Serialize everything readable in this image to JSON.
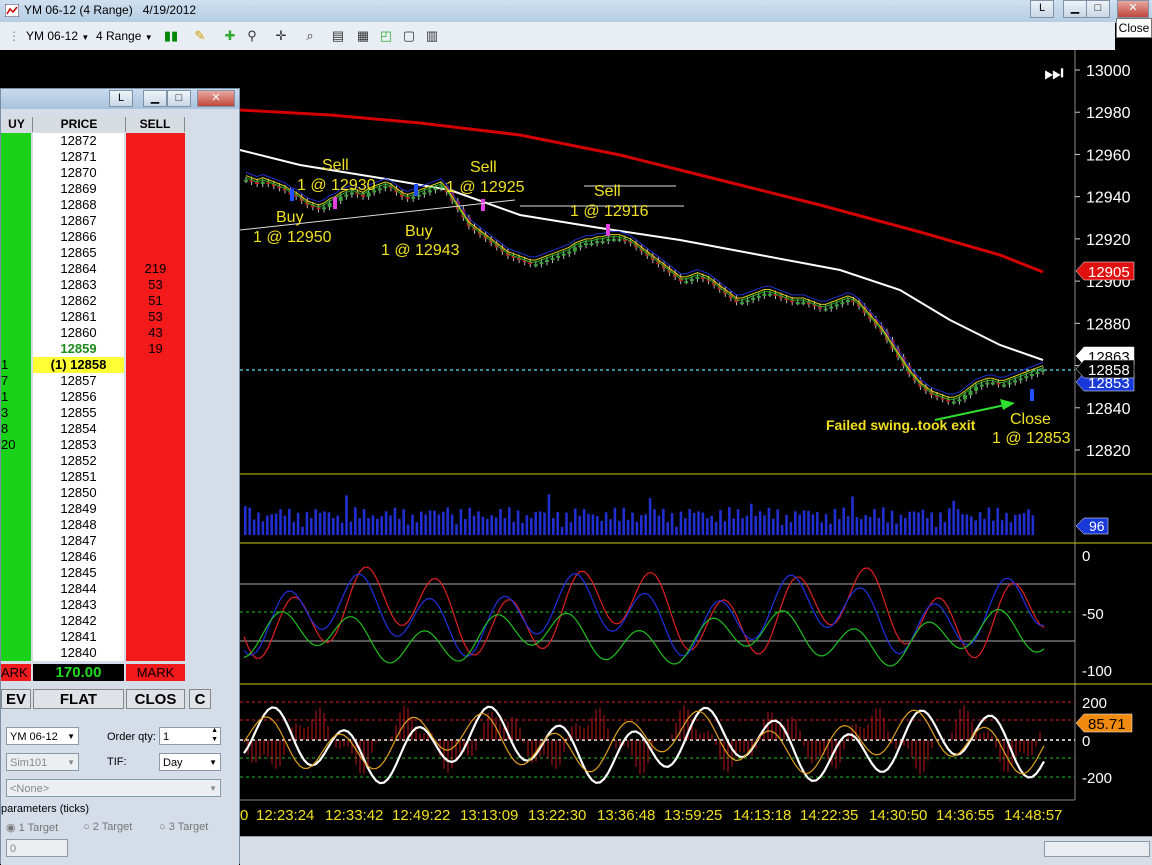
{
  "window": {
    "title": "YM 06-12 (4 Range)   4/19/2012",
    "close_tooltip": "Close",
    "btn_l": "L"
  },
  "toolbar": {
    "instrument": "YM 06-12",
    "interval": "4 Range"
  },
  "chart_data": {
    "type": "candlestick-multi-panel",
    "price_axis": {
      "ticks": [
        "13000",
        "12980",
        "12960",
        "12940",
        "12920",
        "12900",
        "12880",
        "12860",
        "12840",
        "12820"
      ]
    },
    "markers": {
      "current_price": "12858",
      "upper_band_price": "12863",
      "lower_band_price": "12853",
      "red_ma": "12905"
    },
    "volume_label": "96",
    "oscillator1_ticks": [
      "0",
      "-50",
      "-100"
    ],
    "oscillator2_ticks": [
      "200",
      "0",
      "-200"
    ],
    "oscillator2_value": "85.71",
    "time_axis": [
      "0",
      "12:23:24",
      "12:33:42",
      "12:49:22",
      "13:13:09",
      "13:22:30",
      "13:36:48",
      "13:59:25",
      "14:13:18",
      "14:22:35",
      "14:30:50",
      "14:36:55",
      "14:48:57"
    ],
    "annotations": [
      {
        "text": "Sell",
        "text2": "1 @ 12930"
      },
      {
        "text": "Buy",
        "text2": "1 @ 12950"
      },
      {
        "text": "Sell",
        "text2": "1 @ 12925"
      },
      {
        "text": "Buy",
        "text2": "1 @ 12943"
      },
      {
        "text": "Sell",
        "text2": "1 @ 12916"
      },
      {
        "text": "Close",
        "text2": "1 @ 12853"
      },
      {
        "text": "Failed swing..took exit",
        "text2": ""
      }
    ],
    "price_series": [
      12948,
      12947,
      12946,
      12947,
      12946,
      12945,
      12944,
      12943,
      12941,
      12940,
      12938,
      12936,
      12935,
      12934,
      12935,
      12937,
      12938,
      12940,
      12941,
      12942,
      12941,
      12940,
      12942,
      12943,
      12944,
      12945,
      12944,
      12942,
      12940,
      12939,
      12940,
      12941,
      12942,
      12943,
      12944,
      12945,
      12942,
      12938,
      12934,
      12930,
      12926,
      12924,
      12922,
      12920,
      12918,
      12916,
      12914,
      12912,
      12911,
      12910,
      12909,
      12908,
      12908,
      12909,
      12910,
      12911,
      12912,
      12913,
      12914,
      12916,
      12917,
      12918,
      12918,
      12919,
      12919,
      12920,
      12920,
      12920,
      12919,
      12918,
      12916,
      12914,
      12912,
      12910,
      12908,
      12906,
      12904,
      12902,
      12900,
      12900,
      12901,
      12902,
      12901,
      12900,
      12898,
      12896,
      12894,
      12892,
      12890,
      12890,
      12891,
      12892,
      12893,
      12894,
      12894,
      12893,
      12892,
      12891,
      12890,
      12890,
      12890,
      12889,
      12888,
      12887,
      12887,
      12888,
      12889,
      12890,
      12891,
      12890,
      12888,
      12885,
      12882,
      12879,
      12876,
      12872,
      12868,
      12864,
      12860,
      12856,
      12853,
      12850,
      12848,
      12846,
      12845,
      12844,
      12843,
      12843,
      12844,
      12846,
      12848,
      12850,
      12851,
      12852,
      12852,
      12851,
      12851,
      12852,
      12853,
      12854,
      12855,
      12856,
      12857,
      12858
    ]
  },
  "dom": {
    "title_btn": "L",
    "headers": {
      "buy": "UY",
      "price": "PRICE",
      "sell": "SELL"
    },
    "rows": [
      {
        "buy": "",
        "price": "12872",
        "sell": ""
      },
      {
        "buy": "",
        "price": "12871",
        "sell": ""
      },
      {
        "buy": "",
        "price": "12870",
        "sell": ""
      },
      {
        "buy": "",
        "price": "12869",
        "sell": ""
      },
      {
        "buy": "",
        "price": "12868",
        "sell": ""
      },
      {
        "buy": "",
        "price": "12867",
        "sell": ""
      },
      {
        "buy": "",
        "price": "12866",
        "sell": ""
      },
      {
        "buy": "",
        "price": "12865",
        "sell": ""
      },
      {
        "buy": "",
        "price": "12864",
        "sell": "219"
      },
      {
        "buy": "",
        "price": "12863",
        "sell": "53"
      },
      {
        "buy": "",
        "price": "12862",
        "sell": "51"
      },
      {
        "buy": "",
        "price": "12861",
        "sell": "53"
      },
      {
        "buy": "",
        "price": "12860",
        "sell": "43"
      },
      {
        "buy": "",
        "price": "12859",
        "sell": "19"
      },
      {
        "buy": "1",
        "price": "(1) 12858",
        "sell": ""
      },
      {
        "buy": "7",
        "price": "12857",
        "sell": ""
      },
      {
        "buy": "1",
        "price": "12856",
        "sell": ""
      },
      {
        "buy": "3",
        "price": "12855",
        "sell": ""
      },
      {
        "buy": "8",
        "price": "12854",
        "sell": ""
      },
      {
        "buy": "20",
        "price": "12853",
        "sell": ""
      },
      {
        "buy": "",
        "price": "12852",
        "sell": ""
      },
      {
        "buy": "",
        "price": "12851",
        "sell": ""
      },
      {
        "buy": "",
        "price": "12850",
        "sell": ""
      },
      {
        "buy": "",
        "price": "12849",
        "sell": ""
      },
      {
        "buy": "",
        "price": "12848",
        "sell": ""
      },
      {
        "buy": "",
        "price": "12847",
        "sell": ""
      },
      {
        "buy": "",
        "price": "12846",
        "sell": ""
      },
      {
        "buy": "",
        "price": "12845",
        "sell": ""
      },
      {
        "buy": "",
        "price": "12844",
        "sell": ""
      },
      {
        "buy": "",
        "price": "12843",
        "sell": ""
      },
      {
        "buy": "",
        "price": "12842",
        "sell": ""
      },
      {
        "buy": "",
        "price": "12841",
        "sell": ""
      },
      {
        "buy": "",
        "price": "12840",
        "sell": ""
      }
    ],
    "mark_left": "ARK",
    "pnl": "170.00",
    "mark_right": "MARK",
    "buttons": {
      "rev": "EV",
      "flat": "FLAT",
      "close": "CLOS",
      "c": "C"
    },
    "instrument": "YM 06-12",
    "order_qty_label": "Order qty:",
    "order_qty": "1",
    "account": "Sim101",
    "tif_label": "TIF:",
    "tif": "Day",
    "strategy": "<None>",
    "params_label": "parameters (ticks)",
    "target1": "1 Target",
    "target2": "2 Target",
    "target3": "3 Target",
    "stop": "0"
  },
  "colors": {
    "up": "#2a8c2a",
    "down": "#c01818",
    "red_ma": "#d40000",
    "white_ma": "#ffffff",
    "annot": "#f0e020",
    "dom_buy": "#19d219",
    "dom_sell": "#f21a1a"
  }
}
